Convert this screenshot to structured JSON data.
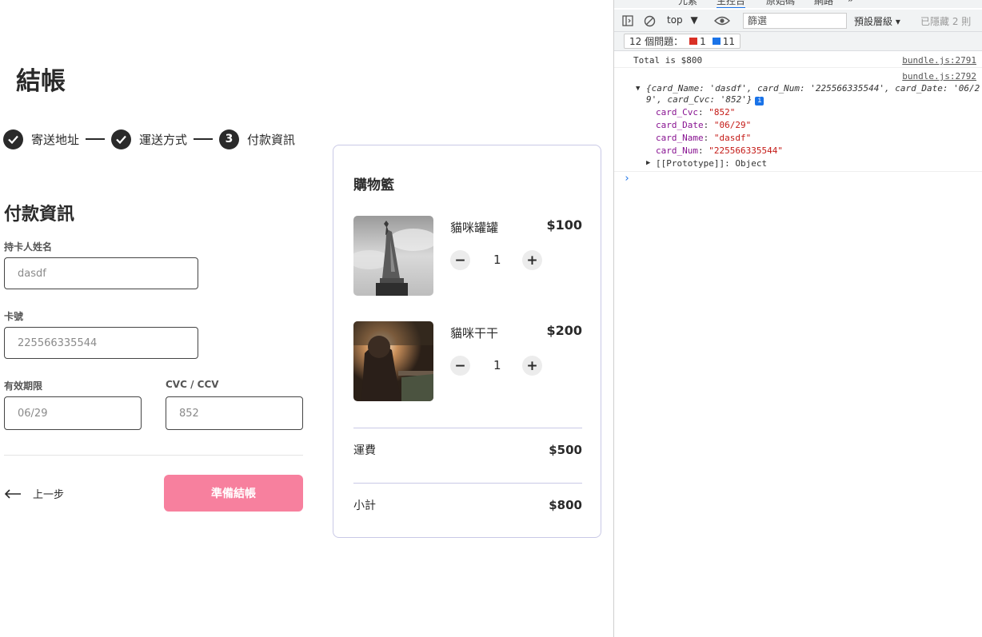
{
  "checkout": {
    "title": "結帳",
    "steps": [
      {
        "label": "寄送地址",
        "state": "done"
      },
      {
        "label": "運送方式",
        "state": "done"
      },
      {
        "label": "付款資訊",
        "state": "current",
        "number": "3"
      }
    ],
    "section_title": "付款資訊",
    "fields": {
      "card_name": {
        "label": "持卡人姓名",
        "value": "dasdf"
      },
      "card_number": {
        "label": "卡號",
        "value": "225566335544"
      },
      "expiry": {
        "label": "有效期限",
        "value": "06/29"
      },
      "cvc": {
        "label": "CVC / CCV",
        "value": "852"
      }
    },
    "back_label": "上一步",
    "submit_label": "準備結帳"
  },
  "cart": {
    "title": "購物籃",
    "items": [
      {
        "name": "貓咪罐罐",
        "price": "$100",
        "qty": "1"
      },
      {
        "name": "貓咪干干",
        "price": "$200",
        "qty": "1"
      }
    ],
    "shipping_label": "運費",
    "shipping_value": "$500",
    "subtotal_label": "小計",
    "subtotal_value": "$800"
  },
  "devtools": {
    "tabs": [
      "元素",
      "主控台",
      "原始碼",
      "網路",
      "»"
    ],
    "context": "top",
    "filter_placeholder": "篩選",
    "levels": "預設層級",
    "hidden": "已隱藏 2 則",
    "issues_label": "12 個問題：",
    "issues_errors": "1",
    "issues_info": "11",
    "console": {
      "log1_text": "Total is $800",
      "log1_source": "bundle.js:2791",
      "log2_source": "bundle.js:2792",
      "obj_line1": "{card_Name: 'dasdf', card_Num: '225566335544', card_Date: '06/2",
      "obj_line2": "9', card_Cvc: '852'}",
      "props": [
        {
          "key": "card_Cvc",
          "value": "\"852\""
        },
        {
          "key": "card_Date",
          "value": "\"06/29\""
        },
        {
          "key": "card_Name",
          "value": "\"dasdf\""
        },
        {
          "key": "card_Num",
          "value": "\"225566335544\""
        }
      ],
      "prototype": "[[Prototype]]: Object"
    }
  },
  "colors": {
    "accent_pink": "#f7809e",
    "dark": "#2a2a2a",
    "cart_border": "#c9c9e6"
  }
}
